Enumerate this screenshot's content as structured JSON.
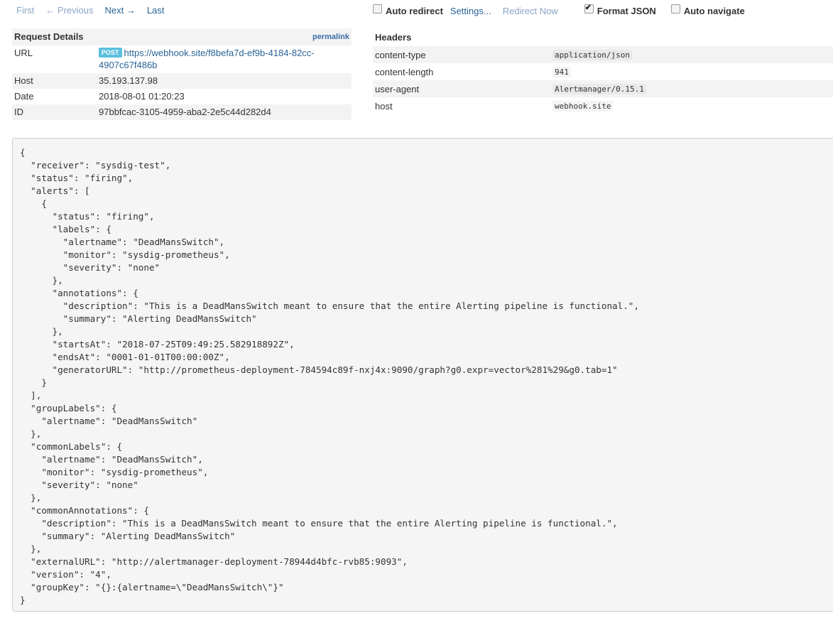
{
  "pager": {
    "first": "First",
    "previous": "← Previous",
    "next": "Next →",
    "last": "Last"
  },
  "options": {
    "auto_redirect": {
      "label": "Auto redirect",
      "checked": false
    },
    "settings": "Settings...",
    "redirect_now": "Redirect Now",
    "format_json": {
      "label": "Format JSON",
      "checked": true
    },
    "auto_navigate": {
      "label": "Auto navigate",
      "checked": false
    }
  },
  "request_details": {
    "title": "Request Details",
    "permalink": "permalink",
    "method": "POST",
    "rows": [
      {
        "label": "URL",
        "value": "https://webhook.site/f8befa7d-ef9b-4184-82cc-4907c67f486b"
      },
      {
        "label": "Host",
        "value": "35.193.137.98"
      },
      {
        "label": "Date",
        "value": "2018-08-01 01:20:23"
      },
      {
        "label": "ID",
        "value": "97bbfcac-3105-4959-aba2-2e5c44d282d4"
      }
    ]
  },
  "headers": {
    "title": "Headers",
    "rows": [
      {
        "name": "content-type",
        "value": "application/json"
      },
      {
        "name": "content-length",
        "value": "941"
      },
      {
        "name": "user-agent",
        "value": "Alertmanager/0.15.1"
      },
      {
        "name": "host",
        "value": "webhook.site"
      }
    ]
  },
  "body_json": "{\n  \"receiver\": \"sysdig-test\",\n  \"status\": \"firing\",\n  \"alerts\": [\n    {\n      \"status\": \"firing\",\n      \"labels\": {\n        \"alertname\": \"DeadMansSwitch\",\n        \"monitor\": \"sysdig-prometheus\",\n        \"severity\": \"none\"\n      },\n      \"annotations\": {\n        \"description\": \"This is a DeadMansSwitch meant to ensure that the entire Alerting pipeline is functional.\",\n        \"summary\": \"Alerting DeadMansSwitch\"\n      },\n      \"startsAt\": \"2018-07-25T09:49:25.582918892Z\",\n      \"endsAt\": \"0001-01-01T00:00:00Z\",\n      \"generatorURL\": \"http://prometheus-deployment-784594c89f-nxj4x:9090/graph?g0.expr=vector%281%29&g0.tab=1\"\n    }\n  ],\n  \"groupLabels\": {\n    \"alertname\": \"DeadMansSwitch\"\n  },\n  \"commonLabels\": {\n    \"alertname\": \"DeadMansSwitch\",\n    \"monitor\": \"sysdig-prometheus\",\n    \"severity\": \"none\"\n  },\n  \"commonAnnotations\": {\n    \"description\": \"This is a DeadMansSwitch meant to ensure that the entire Alerting pipeline is functional.\",\n    \"summary\": \"Alerting DeadMansSwitch\"\n  },\n  \"externalURL\": \"http://alertmanager-deployment-78944d4bfc-rvb85:9093\",\n  \"version\": \"4\",\n  \"groupKey\": \"{}:{alertname=\\\"DeadMansSwitch\\\"}\"\n}"
}
